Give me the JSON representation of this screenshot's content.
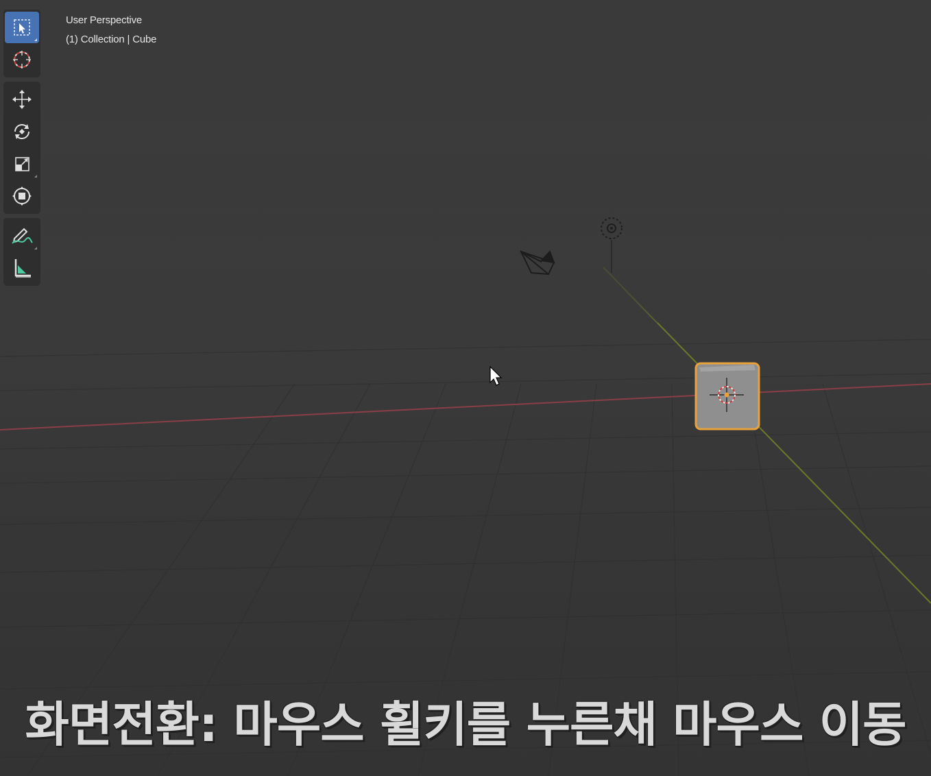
{
  "viewport": {
    "view_label": "User Perspective",
    "collection_label": "(1) Collection | Cube"
  },
  "toolbar": {
    "tools": [
      {
        "name": "select-box",
        "icon": "select-box-icon",
        "active": true
      },
      {
        "name": "cursor",
        "icon": "cursor-3d-icon",
        "active": false
      },
      {
        "name": "move",
        "icon": "move-icon",
        "active": false
      },
      {
        "name": "rotate",
        "icon": "rotate-icon",
        "active": false
      },
      {
        "name": "scale",
        "icon": "scale-icon",
        "active": false
      },
      {
        "name": "transform",
        "icon": "transform-icon",
        "active": false
      },
      {
        "name": "annotate",
        "icon": "annotate-icon",
        "active": false
      },
      {
        "name": "measure",
        "icon": "measure-icon",
        "active": false
      }
    ]
  },
  "subtitle": {
    "text": "화면전환: 마우스 휠키를 누른채 마우스 이동"
  },
  "colors": {
    "background": "#3a3a3a",
    "x_axis": "#8a3f48",
    "y_axis": "#6b7a2a",
    "selection_outline": "#e8a23c",
    "active_tool": "#4772b3"
  }
}
